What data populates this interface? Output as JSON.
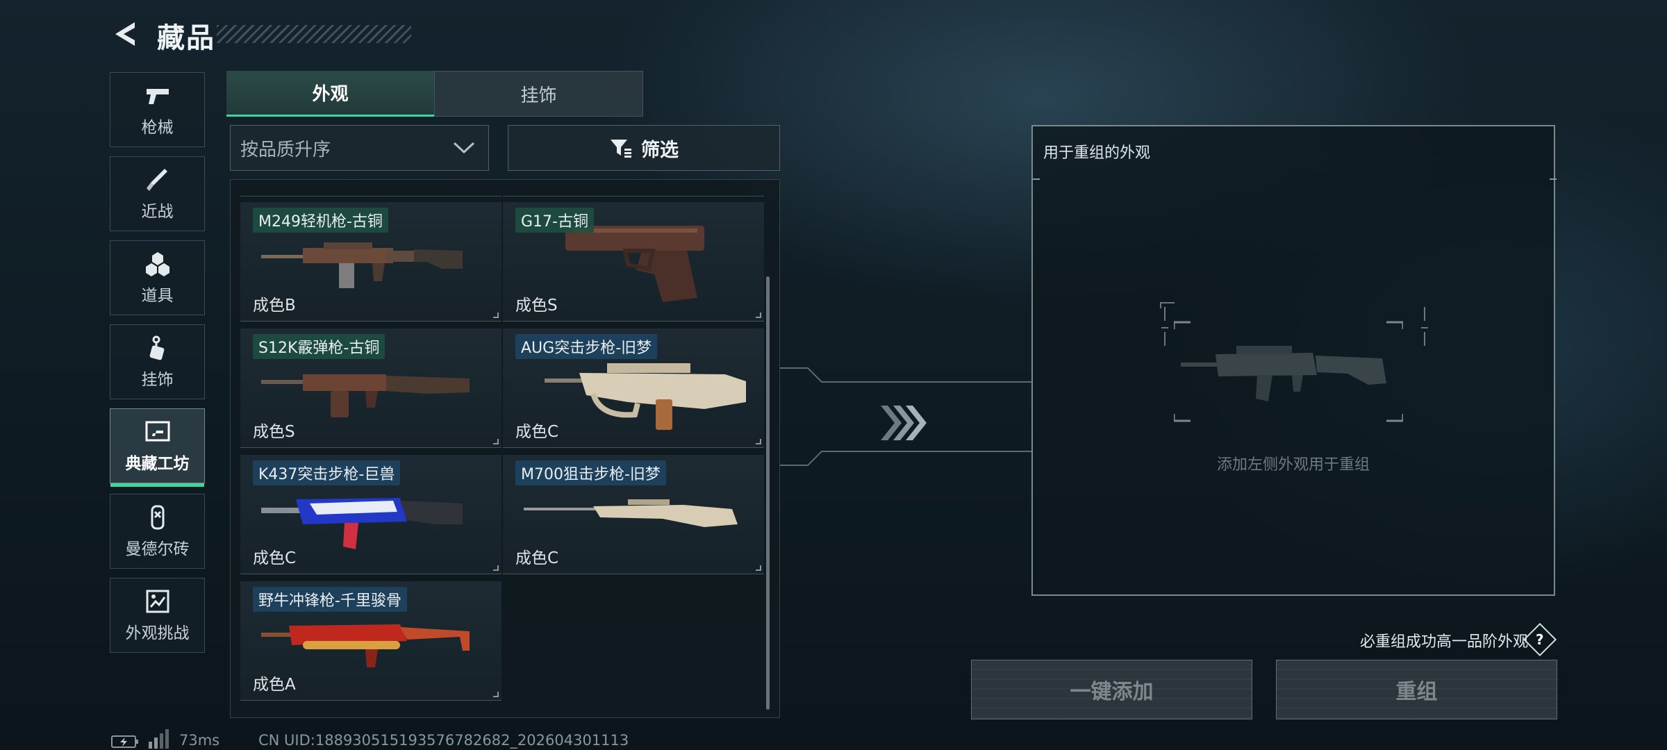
{
  "header": {
    "title": "藏品"
  },
  "nav": {
    "items": [
      {
        "label": "枪械",
        "icon": "pistol-icon"
      },
      {
        "label": "近战",
        "icon": "knife-icon"
      },
      {
        "label": "道具",
        "icon": "grenade-icon"
      },
      {
        "label": "挂饰",
        "icon": "charm-icon"
      },
      {
        "label": "典藏工坊",
        "icon": "workshop-icon",
        "active": true
      },
      {
        "label": "曼德尔砖",
        "icon": "brick-icon"
      },
      {
        "label": "外观挑战",
        "icon": "challenge-icon"
      }
    ]
  },
  "tabs": {
    "appearance": "外观",
    "charms": "挂饰",
    "active": "外观"
  },
  "sort": {
    "value": "按品质升序"
  },
  "filter": {
    "label": "筛选"
  },
  "grid": {
    "items": [
      {
        "name": "M249轻机枪-古铜",
        "grade": "成色B",
        "tag": "bronze"
      },
      {
        "name": "G17-古铜",
        "grade": "成色S",
        "tag": "bronze"
      },
      {
        "name": "S12K霰弹枪-古铜",
        "grade": "成色S",
        "tag": "bronze"
      },
      {
        "name": "AUG突击步枪-旧梦",
        "grade": "成色C",
        "tag": "dream"
      },
      {
        "name": "K437突击步枪-巨兽",
        "grade": "成色C",
        "tag": "beast"
      },
      {
        "name": "M700狙击步枪-旧梦",
        "grade": "成色C",
        "tag": "dream"
      },
      {
        "name": "野牛冲锋枪-千里骏骨",
        "grade": "成色A",
        "tag": "dream"
      }
    ]
  },
  "reorg": {
    "title": "用于重组的外观",
    "placeholder": "添加左侧外观用于重组",
    "guarantee": "必重组成功高一品阶外观",
    "help": "?",
    "add_all": "一键添加",
    "reorganize": "重组"
  },
  "status": {
    "ping": "73ms",
    "uid": "CN UID:1889305151935767826​82_202604301113"
  },
  "colors": {
    "accent": "#3fd6a0",
    "bronze_tag": "#1e4e40",
    "dream_tag": "#1e4260"
  }
}
